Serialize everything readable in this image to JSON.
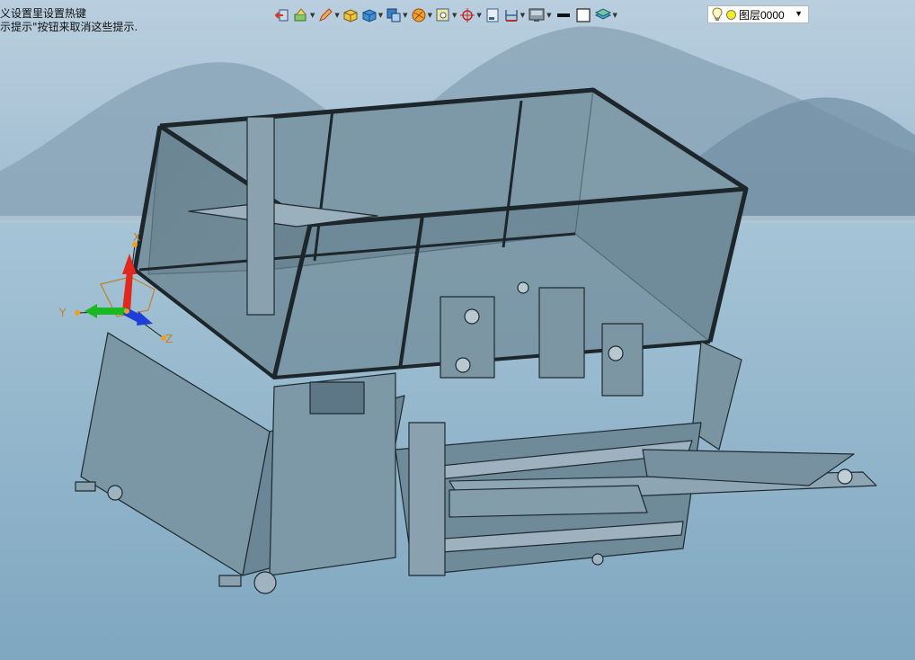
{
  "hint": {
    "line1": "义设置里设置热键",
    "line2": "示提示\"按钮来取消这些提示."
  },
  "toolbar": {
    "buttons": [
      {
        "icon": "exit-sketch-icon",
        "dropdown": false
      },
      {
        "icon": "sketch-tools-icon",
        "dropdown": true
      },
      {
        "icon": "pencil-icon",
        "dropdown": true
      },
      {
        "icon": "solid-box-icon",
        "dropdown": false
      },
      {
        "icon": "cube-view-icon",
        "dropdown": true
      },
      {
        "icon": "view-orientation-icon",
        "dropdown": true
      },
      {
        "icon": "render-sphere-icon",
        "dropdown": true
      },
      {
        "icon": "zoom-window-icon",
        "dropdown": true
      },
      {
        "icon": "snap-target-icon",
        "dropdown": true
      },
      {
        "icon": "section-view-icon",
        "dropdown": false
      },
      {
        "icon": "dimension-icon",
        "dropdown": true
      },
      {
        "icon": "display-mode-icon",
        "dropdown": true
      },
      {
        "icon": "line-color-icon",
        "dropdown": false
      },
      {
        "icon": "frame-icon",
        "dropdown": false
      },
      {
        "icon": "layer-stack-icon",
        "dropdown": true
      }
    ]
  },
  "layer_select": {
    "label": "图层0000",
    "bulb_icon": "lightbulb-icon",
    "color": "#f6ee1c"
  },
  "triad": {
    "x_label": "X",
    "y_label": "Y",
    "z_label": "Z"
  },
  "colors": {
    "model_fill": "#7d98a6",
    "model_dark": "#2c3b44",
    "sky": "#a9c3d6",
    "sea": "#8fb5cc"
  }
}
